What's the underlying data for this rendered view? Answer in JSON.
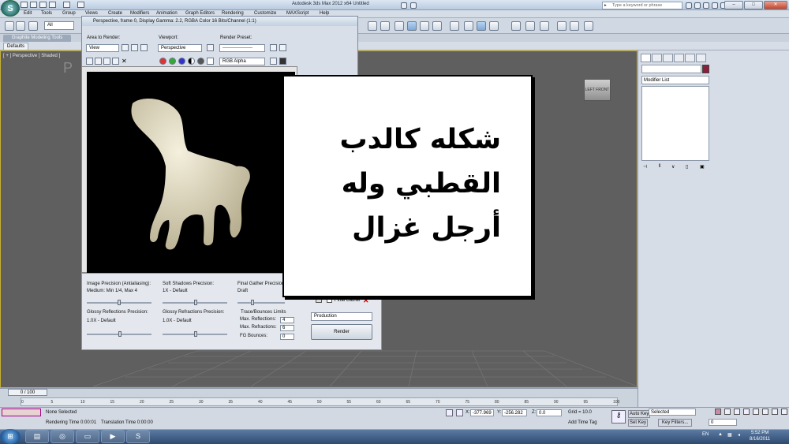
{
  "window": {
    "title": "Autodesk 3ds Max  2012 x64        Untitled",
    "search_placeholder": "Type a keyword or phrase",
    "logo_label": "S"
  },
  "menu": [
    "Edit",
    "Tools",
    "Group",
    "Views",
    "Create",
    "Modifiers",
    "Animation",
    "Graph Editors",
    "Rendering",
    "Customize",
    "MAXScript",
    "Help"
  ],
  "toolbar": {
    "selection_filter": "All"
  },
  "ribbon": {
    "tab": "Graphite Modeling Tools",
    "sub_tab": "Defaults"
  },
  "viewport": {
    "label": "[ + ] Perspective ] Shaded ]",
    "big_label": "P",
    "viewcube_left": "LEFT",
    "viewcube_front": "FRONT"
  },
  "render_window": {
    "title": "Perspective, frame 0, Display Gamma: 2.2, RGBA Color 16 Bits/Channel (1:1)",
    "area_label": "Area to Render:",
    "area_value": "View",
    "viewport_label": "Viewport:",
    "viewport_value": "Perspective",
    "preset_label": "Render Preset:",
    "preset_value": "-------------------",
    "channel_value": "RGB Alpha"
  },
  "settings": {
    "image_precision_label": "Image Precision (Antialiasing):",
    "image_precision_value": "Medium: Min 1/4, Max 4",
    "soft_shadows_label": "Soft Shadows Precision:",
    "soft_shadows_value": "1X - Default",
    "final_gather_label": "Final Gather Precision:",
    "final_gather_value": "Draft",
    "glossy_refl_label": "Glossy Reflections Precision:",
    "glossy_refl_value": "1.0X - Default",
    "glossy_refr_label": "Glossy Refractions Precision:",
    "glossy_refr_value": "1.0X - Default",
    "trace_label": "Trace/Bounces Limits",
    "max_refl_label": "Max. Reflections:",
    "max_refl_value": "4",
    "max_refr_label": "Max. Refractions:",
    "max_refr_value": "6",
    "fg_bounces_label": "FG Bounces:",
    "fg_bounces_value": "0",
    "final_gather_checkbox": "Final Gather",
    "production": "Production",
    "render_button": "Render"
  },
  "overlay_text": [
    "شكله كالدب",
    "القطبي وله",
    "أرجل غزال"
  ],
  "command_panel": {
    "modifier_list": "Modifier List"
  },
  "timeline": {
    "slider": "0 / 100",
    "ticks": [
      "0",
      "5",
      "10",
      "15",
      "20",
      "25",
      "30",
      "35",
      "40",
      "45",
      "50",
      "55",
      "60",
      "65",
      "70",
      "75",
      "80",
      "85",
      "90",
      "95",
      "100"
    ]
  },
  "status": {
    "selection": "None Selected",
    "rendering_time_label": "Rendering Time  0:00:01",
    "translation_time_label": "Translation Time  0:00:00",
    "x_label": "X:",
    "x_value": "-377.969",
    "y_label": "Y:",
    "y_value": "-256.282",
    "z_label": "Z:",
    "z_value": "0.0",
    "grid": "Grid = 10.0",
    "add_time_tag": "Add Time Tag",
    "auto_key": "Auto Key",
    "set_key": "Set Key",
    "selected": "Selected",
    "key_filters": "Key Filters...",
    "frame": "0"
  },
  "taskbar": {
    "lang": "EN",
    "time": "5:52 PM",
    "date": "8/16/2011"
  }
}
